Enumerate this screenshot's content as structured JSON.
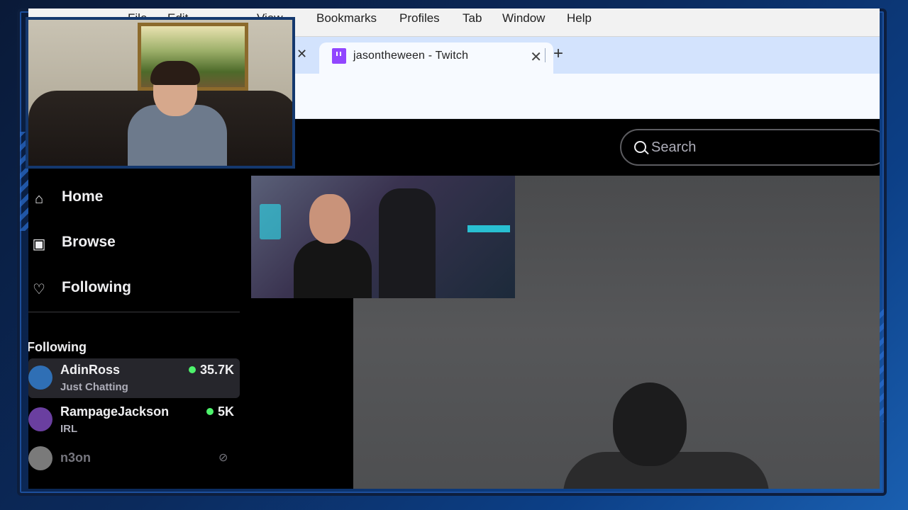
{
  "menubar": {
    "items": [
      "File",
      "Edit",
      "View",
      "Bookmarks",
      "Profiles",
      "Tab",
      "Window",
      "Help"
    ]
  },
  "tabs": {
    "active_title": "jasontheween - Twitch",
    "close_symbol": "✕",
    "new_tab_symbol": "+"
  },
  "twitch": {
    "search_placeholder": "Search",
    "nav": [
      {
        "label": "Home",
        "icon": "home-icon"
      },
      {
        "label": "Browse",
        "icon": "browse-icon"
      },
      {
        "label": "Following",
        "icon": "heart-icon"
      }
    ],
    "section_title": "Following",
    "channels": [
      {
        "name": "AdinRoss",
        "game": "Just Chatting",
        "viewers": "35.7K",
        "live": true,
        "avatar_color": "#2f6fb5"
      },
      {
        "name": "RampageJackson",
        "game": "IRL",
        "viewers": "5K",
        "live": true,
        "avatar_color": "#6a3fa0"
      },
      {
        "name": "n3on",
        "game": "",
        "viewers": "",
        "live": false,
        "avatar_color": "#7a7a7a"
      }
    ]
  },
  "colors": {
    "live_green": "#4ef36c",
    "twitch_purple": "#9146ff",
    "overlay_blue": "#14386e"
  }
}
